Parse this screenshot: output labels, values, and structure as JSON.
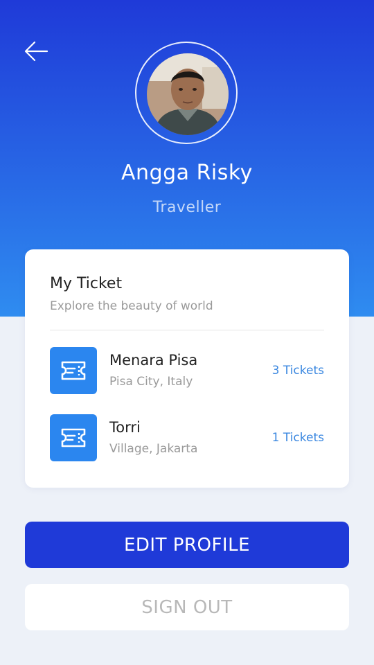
{
  "profile": {
    "name": "Angga Risky",
    "role": "Traveller"
  },
  "tickets_card": {
    "title": "My Ticket",
    "subtitle": "Explore the beauty of world",
    "items": [
      {
        "name": "Menara Pisa",
        "location": "Pisa City, Italy",
        "count": "3 Tickets"
      },
      {
        "name": "Torri",
        "location": "Village, Jakarta",
        "count": "1 Tickets"
      }
    ]
  },
  "actions": {
    "edit_label": "EDIT PROFILE",
    "signout_label": "SIGN OUT"
  },
  "icons": {
    "back": "arrow-left-icon",
    "ticket": "ticket-icon"
  },
  "colors": {
    "primary": "#1f3ad8",
    "gradient_end": "#2f8cf0",
    "ticket_icon_bg": "#2b86ef",
    "ticket_count": "#3a87e0",
    "background": "#edf1f8"
  }
}
